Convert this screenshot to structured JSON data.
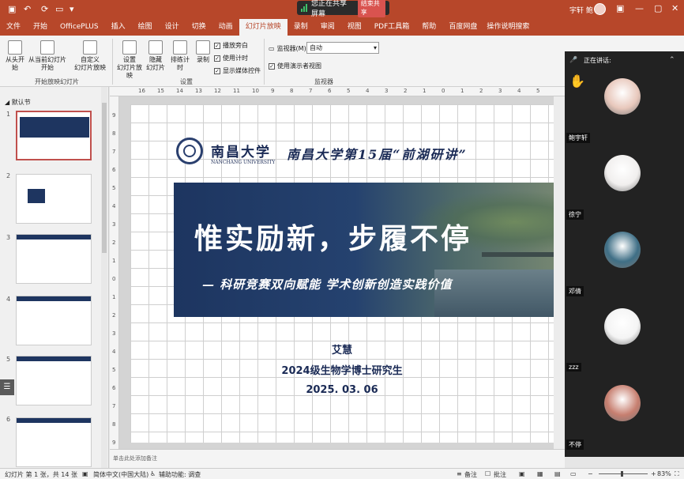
{
  "titlebar": {
    "share_status": "您正在共享屏幕",
    "stop_share": "结束共享",
    "user_name": "宇轩 鲍"
  },
  "tabs": [
    {
      "label": "文件"
    },
    {
      "label": "开始"
    },
    {
      "label": "OfficePLUS"
    },
    {
      "label": "插入"
    },
    {
      "label": "绘图"
    },
    {
      "label": "设计"
    },
    {
      "label": "切换"
    },
    {
      "label": "动画"
    },
    {
      "label": "幻灯片放映",
      "active": true
    },
    {
      "label": "录制"
    },
    {
      "label": "审阅"
    },
    {
      "label": "视图"
    },
    {
      "label": "PDF工具箱"
    },
    {
      "label": "帮助"
    },
    {
      "label": "百度网盘"
    },
    {
      "label": "操作说明搜索"
    }
  ],
  "ribbon": {
    "from_start": "从头开始",
    "from_current_1": "从当前幻灯片",
    "from_current_2": "开始",
    "custom_1": "自定义",
    "custom_2": "幻灯片放映",
    "group_start": "开始放映幻灯片",
    "setup_1": "设置",
    "setup_2": "幻灯片放映",
    "hide_1": "隐藏",
    "hide_2": "幻灯片",
    "rehearse": "排练计时",
    "record": "录制",
    "chk_narration": "播放旁白",
    "chk_timings": "使用计时",
    "chk_media": "显示媒体控件",
    "group_setup": "设置",
    "monitor_label": "监视器(M):",
    "monitor_value": "自动",
    "chk_presenter": "使用演示者视图",
    "group_monitor": "监视器"
  },
  "thumbs": {
    "section": "默认节",
    "nums": [
      "1",
      "2",
      "3",
      "4",
      "5",
      "6"
    ]
  },
  "ruler": {
    "h": [
      "16",
      "15",
      "14",
      "13",
      "12",
      "11",
      "10",
      "9",
      "8",
      "7",
      "6",
      "5",
      "4",
      "3",
      "2",
      "1",
      "0",
      "1",
      "2",
      "3",
      "4",
      "5"
    ],
    "v": [
      "9",
      "8",
      "7",
      "6",
      "5",
      "4",
      "3",
      "2",
      "1",
      "0",
      "1",
      "2",
      "3",
      "4",
      "5",
      "6",
      "7",
      "8",
      "9"
    ]
  },
  "slide": {
    "uni_name": "南昌大学",
    "uni_en": "NANCHANG UNIVERSITY",
    "event_title": "南昌大学第15届“前湖研讲”",
    "main_title": "惟实励新，步履不停",
    "subtitle": "— 科研竞赛双向赋能 学术创新创造实践价值",
    "speaker": "艾慧",
    "speaker_title": "2024级生物学博士研究生",
    "date": "2025. 03. 06"
  },
  "notes_placeholder": "单击此处添加备注",
  "participants": {
    "header": "正在讲话:",
    "people": [
      {
        "name": "鲍宇轩",
        "color": "#e8c8bc"
      },
      {
        "name": "徐宁",
        "color": "#f1efee"
      },
      {
        "name": "邓倩",
        "color": "#3f6f86"
      },
      {
        "name": "zzz",
        "color": "#f4f4f4"
      },
      {
        "name": "不停",
        "color": "#c77f70"
      }
    ]
  },
  "status": {
    "slide_info": "幻灯片 第 1 张，共 14 张",
    "language": "简体中文(中国大陆)",
    "accessibility": "辅助功能: 调查",
    "notes": "备注",
    "comments": "批注",
    "zoom": "83%"
  }
}
